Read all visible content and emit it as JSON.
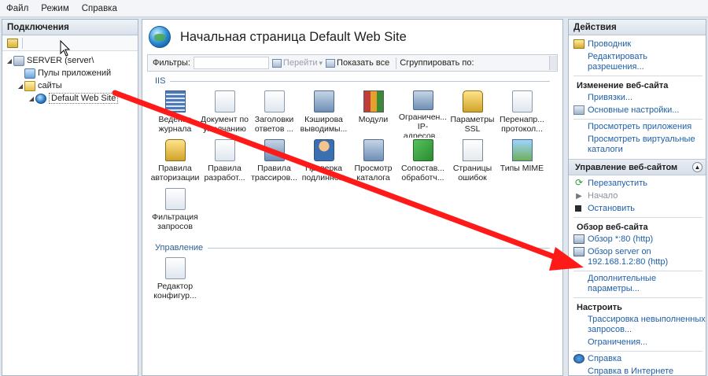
{
  "menu": [
    "Файл",
    "Режим",
    "Справка"
  ],
  "left_panel": {
    "title": "Подключения",
    "tree": [
      {
        "label": "SERVER (server\\",
        "icon": "server-icon",
        "arrow": "◢",
        "indent": 0
      },
      {
        "label": "Пулы приложений",
        "icon": "app-pool-icon",
        "arrow": "",
        "indent": 1
      },
      {
        "label": "сайты",
        "icon": "folder-icon",
        "arrow": "◢",
        "indent": 1
      },
      {
        "label": "Default Web Site",
        "icon": "globe-icon",
        "arrow": "◢",
        "indent": 2
      }
    ]
  },
  "center": {
    "title": "Начальная страница Default Web Site",
    "filter_label": "Фильтры:",
    "go_label": "Перейти",
    "show_all_label": "Показать все",
    "group_by_label": "Сгруппировать по:",
    "sections": [
      {
        "label": "IIS",
        "features": [
          {
            "label": "Ведение журнала",
            "icon": "log-icon",
            "cls": "ic-log"
          },
          {
            "label": "Документ по умолчанию",
            "icon": "default-document-icon",
            "cls": "ic-doc"
          },
          {
            "label": "Заголовки ответов ...",
            "icon": "http-headers-icon",
            "cls": "ic-doc"
          },
          {
            "label": "Кэширова выводимы...",
            "icon": "output-cache-icon",
            "cls": "ic-net"
          },
          {
            "label": "Модули",
            "icon": "modules-icon",
            "cls": "ic-mod"
          },
          {
            "label": "Ограничен... IP-адресов...",
            "icon": "ip-restrictions-icon",
            "cls": "ic-net"
          },
          {
            "label": "Параметры SSL",
            "icon": "ssl-lock-icon",
            "cls": "ic-lock"
          },
          {
            "label": "Перенапр... протокол...",
            "icon": "redirect-icon",
            "cls": "ic-doc"
          },
          {
            "label": "Правила авторизации",
            "icon": "authorization-icon",
            "cls": "ic-lock"
          },
          {
            "label": "Правила разработ...",
            "icon": "webdav-icon",
            "cls": "ic-doc"
          },
          {
            "label": "Правила трассиров...",
            "icon": "tracing-icon",
            "cls": "ic-net"
          },
          {
            "label": "Проверка подлинно...",
            "icon": "authentication-icon",
            "cls": "ic-user"
          },
          {
            "label": "Просмотр каталога",
            "icon": "directory-browsing-icon",
            "cls": "ic-net"
          },
          {
            "label": "Сопостав... обработч...",
            "icon": "handler-mappings-icon",
            "cls": "ic-green"
          },
          {
            "label": "Страницы ошибок",
            "icon": "error-pages-icon",
            "cls": "ic-404"
          },
          {
            "label": "Типы MIME",
            "icon": "mime-types-icon",
            "cls": "ic-img"
          },
          {
            "label": "Фильтрация запросов",
            "icon": "request-filtering-icon",
            "cls": "ic-doc"
          }
        ]
      },
      {
        "label": "Управление",
        "features": [
          {
            "label": "Редактор конфигур...",
            "icon": "config-editor-icon",
            "cls": "ic-doc"
          }
        ]
      }
    ]
  },
  "right_panel": {
    "title": "Действия",
    "explore": "Проводник",
    "edit_perms": "Редактировать разрешения...",
    "edit_site_h": "Изменение веб-сайта",
    "bindings": "Привязки...",
    "basic_settings": "Основные настройки...",
    "view_apps": "Просмотреть приложения",
    "view_vdirs": "Просмотреть виртуальные каталоги",
    "manage_h": "Управление веб-сайтом",
    "restart": "Перезапустить",
    "start": "Начало",
    "stop": "Остановить",
    "browse_h": "Обзор веб-сайта",
    "browse_80": "Обзор *:80 (http)",
    "browse_ip": "Обзор server on 192.168.1.2:80 (http)",
    "advanced": "Дополнительные параметры...",
    "configure_h": "Настроить",
    "failed_tracing": "Трассировка невыполненных запросов...",
    "limits": "Ограничения...",
    "help": "Справка",
    "help_online": "Справка в Интернете"
  },
  "annotation": {
    "arrow_color": "#ff1a1a"
  }
}
